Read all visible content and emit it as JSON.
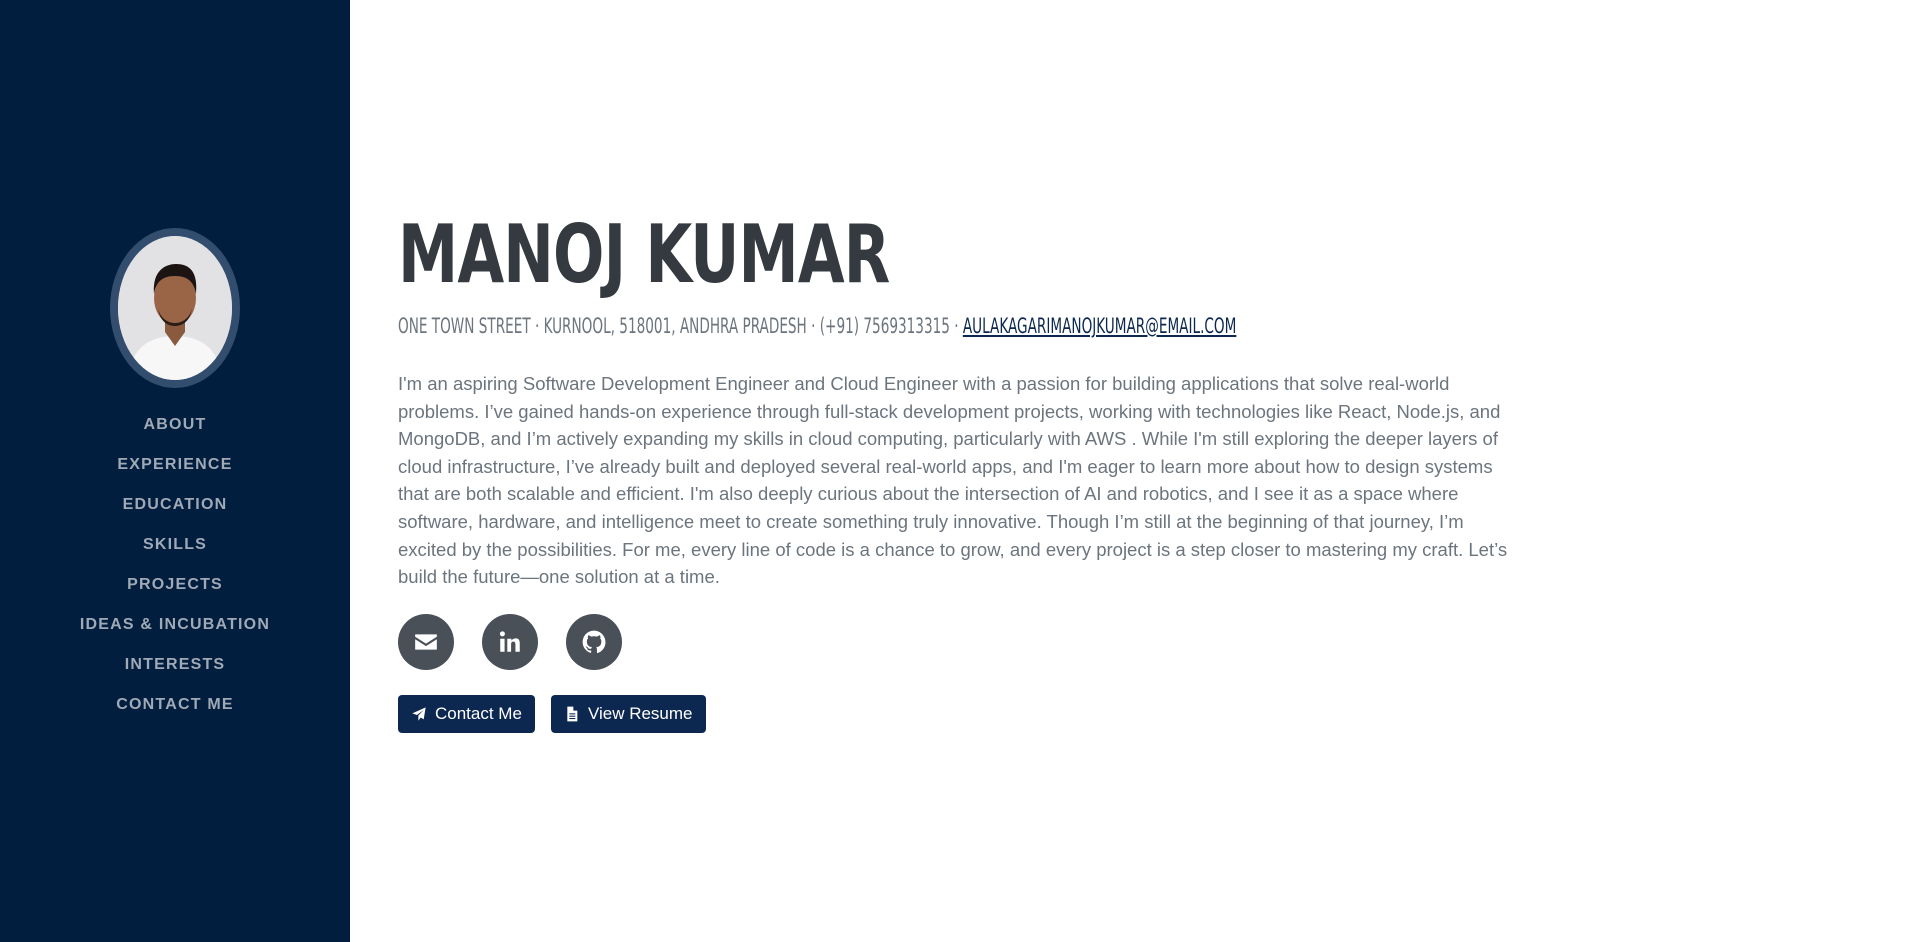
{
  "sidebar": {
    "avatar_alt": "Profile photo",
    "nav": [
      {
        "label": "ABOUT"
      },
      {
        "label": "EXPERIENCE"
      },
      {
        "label": "EDUCATION"
      },
      {
        "label": "SKILLS"
      },
      {
        "label": "PROJECTS"
      },
      {
        "label": "IDEAS & INCUBATION"
      },
      {
        "label": "INTERESTS"
      },
      {
        "label": "CONTACT ME"
      }
    ]
  },
  "about": {
    "name": "MANOJ KUMAR",
    "address": "ONE TOWN STREET · KURNOOL, 518001, ANDHRA PRADESH · (+91) 7569313315 · ",
    "email": "AULAKAGARIMANOJKUMAR@EMAIL.COM",
    "bio": "I'm an aspiring Software Development Engineer and Cloud Engineer with a passion for building applications that solve real-world problems. I’ve gained hands-on experience through full-stack development projects, working with technologies like React, Node.js, and MongoDB, and I’m actively expanding my skills in cloud computing, particularly with AWS . While I'm still exploring the deeper layers of cloud infrastructure, I’ve already built and deployed several real-world apps, and I'm eager to learn more about how to design systems that are both scalable and efficient. I'm also deeply curious about the intersection of AI and robotics, and I see it as a space where software, hardware, and intelligence meet to create something truly innovative. Though I’m still at the beginning of that journey, I’m excited by the possibilities. For me, every line of code is a chance to grow, and every project is a step closer to mastering my craft. Let’s build the future—one solution at a time.",
    "socials": [
      {
        "icon": "envelope-icon"
      },
      {
        "icon": "linkedin-icon"
      },
      {
        "icon": "github-icon"
      }
    ],
    "buttons": {
      "contact_label": "Contact Me",
      "resume_label": "View Resume"
    }
  },
  "colors": {
    "sidebar_bg": "#021e3e",
    "accent": "#0d2850",
    "text_muted": "#6c757d",
    "name": "#343a40"
  }
}
